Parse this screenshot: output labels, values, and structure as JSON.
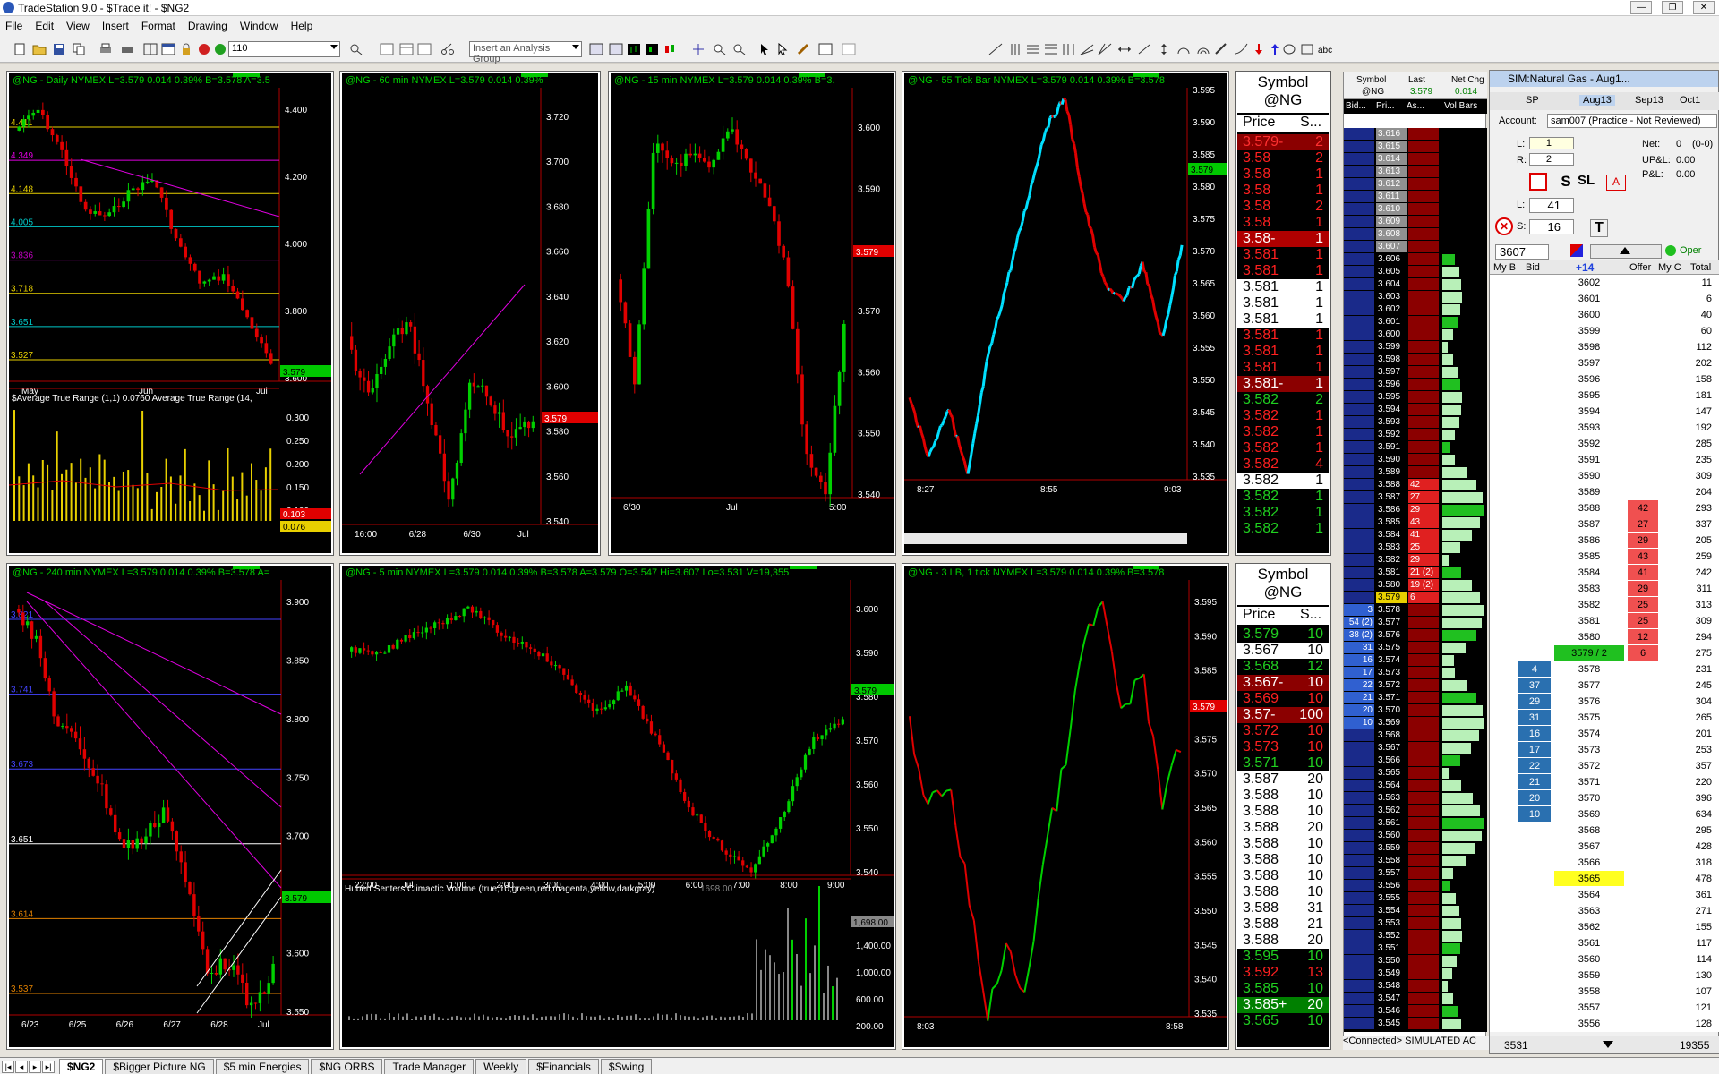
{
  "app": {
    "title": "TradeStation 9.0 - $Trade it! - $NG2"
  },
  "menu": [
    "File",
    "Edit",
    "View",
    "Insert",
    "Format",
    "Drawing",
    "Window",
    "Help"
  ],
  "toolbar": {
    "interval_value": "110",
    "analysis_group_placeholder": "Insert an Analysis Group"
  },
  "charts": [
    {
      "header": "@NG - Daily  NYMEX  L=3.579  0.014   0.39%   B=3.578  A=3.5",
      "levels": [
        "4.411",
        "4.349",
        "4.148",
        "4.005",
        "3.836",
        "3.718",
        "3.651",
        "3.527"
      ],
      "axis": [
        "4.400",
        "4.200",
        "4.000",
        "3.800",
        "3.600"
      ],
      "price_tag": "3.579",
      "indicator": "$Average True Range (1,1)   0.0760  Average True Range (14,",
      "ind_axis": [
        "0.300",
        "0.250",
        "0.200",
        "0.150",
        "0.100"
      ],
      "ind_tags": [
        "0.103",
        "0.076"
      ],
      "xlabels": [
        "May",
        "Jun",
        "Jul"
      ]
    },
    {
      "header": "@NG - 60 min  NYMEX  L=3.579  0.014   0.39%",
      "axis": [
        "3.720",
        "3.700",
        "3.680",
        "3.660",
        "3.640",
        "3.620",
        "3.600",
        "3.580",
        "3.560",
        "3.540"
      ],
      "price_tag": "3.579",
      "xlabels": [
        "16:00",
        "6/28",
        "6/30",
        "Jul"
      ]
    },
    {
      "header": "@NG - 15 min  NYMEX  L=3.579  0.014   0.39%   B=3.",
      "axis": [
        "3.600",
        "3.590",
        "3.580",
        "3.570",
        "3.560",
        "3.550",
        "3.540"
      ],
      "price_tag": "3.579",
      "xlabels": [
        "6/30",
        "Jul",
        "5:00"
      ]
    },
    {
      "header": "@NG - 55 Tick Bar  NYMEX  L=3.579  0.014   0.39%   B=3.578",
      "axis": [
        "3.595",
        "3.590",
        "3.585",
        "3.580",
        "3.575",
        "3.570",
        "3.565",
        "3.560",
        "3.555",
        "3.550",
        "3.545",
        "3.540",
        "3.535"
      ],
      "price_tag": "3.579",
      "xlabels": [
        "8:27",
        "8:55",
        "9:03"
      ]
    },
    {
      "header": "@NG - 240 min  NYMEX  L=3.579  0.014   0.39%   B=3.578  A=",
      "levels": [
        "3.821",
        "3.741",
        "3.673",
        "3.651",
        "3.614",
        "3.537"
      ],
      "axis": [
        "3.900",
        "3.850",
        "3.800",
        "3.750",
        "3.700",
        "3.650",
        "3.600",
        "3.550"
      ],
      "price_tag": "3.579",
      "xlabels": [
        "6/23",
        "6/25",
        "6/26",
        "6/27",
        "6/28",
        "Jul"
      ]
    },
    {
      "header": "@NG - 5 min  NYMEX  L=3.579  0.014   0.39%   B=3.578  A=3.579  O=3.547  Hi=3.607  Lo=3.531  V=19,355",
      "axis": [
        "3.600",
        "3.590",
        "3.580",
        "3.570",
        "3.560",
        "3.550",
        "3.540"
      ],
      "price_tag": "3.579",
      "indicator": "Hubert Senters Climactic Volume (true,10,green,red,magenta,yellow,darkgray)",
      "ind_value": "1698.00",
      "ind_axis": [
        "1,800.00",
        "1,400.00",
        "1,000.00",
        "600.00",
        "200.00"
      ],
      "ind_tag": "1,698.00",
      "xlabels": [
        "22:00",
        "Jul",
        "1:00",
        "2:00",
        "3:00",
        "4:00",
        "5:00",
        "6:00",
        "7:00",
        "8:00",
        "9:00"
      ]
    },
    {
      "header": "@NG - 3 LB, 1 tick  NYMEX  L=3.579  0.014   0.39%   B=3.578",
      "axis": [
        "3.595",
        "3.590",
        "3.585",
        "3.580",
        "3.575",
        "3.570",
        "3.565",
        "3.560",
        "3.555",
        "3.550",
        "3.545",
        "3.540",
        "3.535"
      ],
      "price_tag": "3.579",
      "xlabels": [
        "8:03",
        "8:58"
      ]
    }
  ],
  "tape_top": {
    "title": "Symbol",
    "symbol": "@NG",
    "col_price": "Price",
    "col_size": "S...",
    "rows": [
      {
        "p": "3.579-",
        "s": "2",
        "c": "#ff3030",
        "bg": "#8b0000"
      },
      {
        "p": "3.58",
        "s": "2",
        "c": "#ff2020",
        "bg": ""
      },
      {
        "p": "3.58",
        "s": "1",
        "c": "#ff2020",
        "bg": ""
      },
      {
        "p": "3.58",
        "s": "1",
        "c": "#ff2020",
        "bg": ""
      },
      {
        "p": "3.58",
        "s": "2",
        "c": "#ff2020",
        "bg": ""
      },
      {
        "p": "3.58",
        "s": "1",
        "c": "#ff2020",
        "bg": ""
      },
      {
        "p": "3.58-",
        "s": "1",
        "c": "#ffffff",
        "bg": "#b00000"
      },
      {
        "p": "3.581",
        "s": "1",
        "c": "#ff2020",
        "bg": ""
      },
      {
        "p": "3.581",
        "s": "1",
        "c": "#ff2020",
        "bg": ""
      },
      {
        "p": "3.581",
        "s": "1",
        "c": "#000000",
        "bg": "#ffffff"
      },
      {
        "p": "3.581",
        "s": "1",
        "c": "#000000",
        "bg": "#ffffff"
      },
      {
        "p": "3.581",
        "s": "1",
        "c": "#000000",
        "bg": "#ffffff"
      },
      {
        "p": "3.581",
        "s": "1",
        "c": "#ff2020",
        "bg": ""
      },
      {
        "p": "3.581",
        "s": "1",
        "c": "#ff2020",
        "bg": ""
      },
      {
        "p": "3.581",
        "s": "1",
        "c": "#ff2020",
        "bg": ""
      },
      {
        "p": "3.581-",
        "s": "1",
        "c": "#ffffff",
        "bg": "#8b0000"
      },
      {
        "p": "3.582",
        "s": "2",
        "c": "#20d020",
        "bg": ""
      },
      {
        "p": "3.582",
        "s": "1",
        "c": "#ff2020",
        "bg": ""
      },
      {
        "p": "3.582",
        "s": "1",
        "c": "#ff2020",
        "bg": ""
      },
      {
        "p": "3.582",
        "s": "1",
        "c": "#ff2020",
        "bg": ""
      },
      {
        "p": "3.582",
        "s": "4",
        "c": "#ff2020",
        "bg": ""
      },
      {
        "p": "3.582",
        "s": "1",
        "c": "#000000",
        "bg": "#ffffff"
      },
      {
        "p": "3.582",
        "s": "1",
        "c": "#20d020",
        "bg": ""
      },
      {
        "p": "3.582",
        "s": "1",
        "c": "#20d020",
        "bg": ""
      },
      {
        "p": "3.582",
        "s": "1",
        "c": "#20d020",
        "bg": ""
      }
    ]
  },
  "tape_bottom": {
    "title": "Symbol",
    "symbol": "@NG",
    "col_price": "Price",
    "col_size": "S...",
    "rows": [
      {
        "p": "3.579",
        "s": "10",
        "c": "#20d020",
        "bg": ""
      },
      {
        "p": "3.567",
        "s": "10",
        "c": "#000000",
        "bg": "#ffffff"
      },
      {
        "p": "3.568",
        "s": "12",
        "c": "#20d020",
        "bg": ""
      },
      {
        "p": "3.567-",
        "s": "10",
        "c": "#ffffff",
        "bg": "#8b0000"
      },
      {
        "p": "3.569",
        "s": "10",
        "c": "#ff2020",
        "bg": ""
      },
      {
        "p": "3.57-",
        "s": "100",
        "c": "#ffffff",
        "bg": "#8b0000"
      },
      {
        "p": "3.572",
        "s": "10",
        "c": "#ff2020",
        "bg": ""
      },
      {
        "p": "3.573",
        "s": "10",
        "c": "#ff2020",
        "bg": ""
      },
      {
        "p": "3.571",
        "s": "10",
        "c": "#20d020",
        "bg": ""
      },
      {
        "p": "3.587",
        "s": "20",
        "c": "#000000",
        "bg": "#ffffff"
      },
      {
        "p": "3.588",
        "s": "10",
        "c": "#000000",
        "bg": "#ffffff"
      },
      {
        "p": "3.588",
        "s": "10",
        "c": "#000000",
        "bg": "#ffffff"
      },
      {
        "p": "3.588",
        "s": "20",
        "c": "#000000",
        "bg": "#ffffff"
      },
      {
        "p": "3.588",
        "s": "10",
        "c": "#000000",
        "bg": "#ffffff"
      },
      {
        "p": "3.588",
        "s": "10",
        "c": "#000000",
        "bg": "#ffffff"
      },
      {
        "p": "3.588",
        "s": "10",
        "c": "#000000",
        "bg": "#ffffff"
      },
      {
        "p": "3.588",
        "s": "10",
        "c": "#000000",
        "bg": "#ffffff"
      },
      {
        "p": "3.588",
        "s": "31",
        "c": "#000000",
        "bg": "#ffffff"
      },
      {
        "p": "3.588",
        "s": "21",
        "c": "#000000",
        "bg": "#ffffff"
      },
      {
        "p": "3.588",
        "s": "20",
        "c": "#000000",
        "bg": "#ffffff"
      },
      {
        "p": "3.595",
        "s": "10",
        "c": "#20d020",
        "bg": ""
      },
      {
        "p": "3.592",
        "s": "13",
        "c": "#ff2020",
        "bg": ""
      },
      {
        "p": "3.585",
        "s": "10",
        "c": "#20d020",
        "bg": ""
      },
      {
        "p": "3.585+",
        "s": "20",
        "c": "#ffffff",
        "bg": "#008000"
      },
      {
        "p": "3.565",
        "s": "10",
        "c": "#20d020",
        "bg": ""
      }
    ]
  },
  "ladder": {
    "headers": [
      "Symbol",
      "Last",
      "Net Chg"
    ],
    "symbol": "@NG",
    "last": "3.579",
    "net_chg": "0.014",
    "sub_headers": [
      "Bid...",
      "Pri...",
      "As...",
      "Vol Bars"
    ],
    "prices": [
      "3.616",
      "3.615",
      "3.614",
      "3.613",
      "3.612",
      "3.611",
      "3.610",
      "3.609",
      "3.608",
      "3.607",
      "3.606",
      "3.605",
      "3.604",
      "3.603",
      "3.602",
      "3.601",
      "3.600",
      "3.599",
      "3.598",
      "3.597",
      "3.596",
      "3.595",
      "3.594",
      "3.593",
      "3.592",
      "3.591",
      "3.590",
      "3.589",
      "3.588",
      "3.587",
      "3.586",
      "3.585",
      "3.584",
      "3.583",
      "3.582",
      "3.581",
      "3.580",
      "3.579",
      "3.578",
      "3.577",
      "3.576",
      "3.575",
      "3.574",
      "3.573",
      "3.572",
      "3.571",
      "3.570",
      "3.569",
      "3.568",
      "3.567",
      "3.566",
      "3.565",
      "3.564",
      "3.563",
      "3.562",
      "3.561",
      "3.560",
      "3.559",
      "3.558",
      "3.557",
      "3.556",
      "3.555",
      "3.554",
      "3.553",
      "3.552",
      "3.551",
      "3.550",
      "3.549",
      "3.548",
      "3.547",
      "3.546",
      "3.545"
    ],
    "asks": {
      "3.588": "42",
      "3.587": "27",
      "3.586": "29",
      "3.585": "43",
      "3.584": "41",
      "3.583": "25",
      "3.582": "29",
      "3.581": "21 (2)",
      "3.580": "19 (2)",
      "3.579": "6"
    },
    "bids": {
      "3.578": "3",
      "3.577": "54 (2)",
      "3.576": "38 (2)",
      "3.575": "31",
      "3.574": "16",
      "3.573": "17",
      "3.572": "22",
      "3.571": "21",
      "3.570": "20",
      "3.569": "10"
    },
    "status": "<Connected> SIMULATED AC"
  },
  "sim": {
    "title": "SIM:Natural Gas - Aug1...",
    "contracts": [
      "SP",
      "Aug13",
      "Sep13",
      "Oct1"
    ],
    "account_label": "Account:",
    "account_value": "sam007 (Practice - Not Reviewed)",
    "l_label": "L:",
    "l_value": "1",
    "r_label": "R:",
    "r_value": "2",
    "net_label": "Net:",
    "net_value": "0",
    "net_extra": "(0-0)",
    "upl_label": "UP&L:",
    "upl_value": "0.00",
    "pl_label": "P&L:",
    "pl_value": "0.00",
    "qty_l_label": "L:",
    "qty_l": "41",
    "qty_s_label": "S:",
    "qty_s": "16",
    "price_box": "3607",
    "open_label": "Oper",
    "columns": [
      "My B",
      "Bid",
      "+14",
      "Offer",
      "My C",
      "Total"
    ],
    "rows": [
      {
        "price": "3602",
        "total": "11"
      },
      {
        "price": "3601",
        "total": "6"
      },
      {
        "price": "3600",
        "total": "40"
      },
      {
        "price": "3599",
        "total": "60"
      },
      {
        "price": "3598",
        "total": "112"
      },
      {
        "price": "3597",
        "total": "202"
      },
      {
        "price": "3596",
        "total": "158"
      },
      {
        "price": "3595",
        "total": "181"
      },
      {
        "price": "3594",
        "total": "147"
      },
      {
        "price": "3593",
        "total": "192"
      },
      {
        "price": "3592",
        "total": "285"
      },
      {
        "price": "3591",
        "total": "235"
      },
      {
        "price": "3590",
        "total": "309"
      },
      {
        "price": "3589",
        "total": "204"
      },
      {
        "price": "3588",
        "offer": "42",
        "total": "293"
      },
      {
        "price": "3587",
        "offer": "27",
        "total": "337"
      },
      {
        "price": "3586",
        "offer": "29",
        "total": "205"
      },
      {
        "price": "3585",
        "offer": "43",
        "total": "259"
      },
      {
        "price": "3584",
        "offer": "41",
        "total": "242"
      },
      {
        "price": "3583",
        "offer": "29",
        "total": "311"
      },
      {
        "price": "3582",
        "offer": "25",
        "total": "313"
      },
      {
        "price": "3581",
        "offer": "25",
        "total": "309"
      },
      {
        "price": "3580",
        "offer": "12",
        "total": "294"
      },
      {
        "price": "3579 / 2",
        "offer": "6",
        "total": "275",
        "last": true
      },
      {
        "price": "3578",
        "bid": "4",
        "total": "231"
      },
      {
        "price": "3577",
        "bid": "37",
        "total": "245"
      },
      {
        "price": "3576",
        "bid": "29",
        "total": "304"
      },
      {
        "price": "3575",
        "bid": "31",
        "total": "265"
      },
      {
        "price": "3574",
        "bid": "16",
        "total": "201"
      },
      {
        "price": "3573",
        "bid": "17",
        "total": "253"
      },
      {
        "price": "3572",
        "bid": "22",
        "total": "357"
      },
      {
        "price": "3571",
        "bid": "21",
        "total": "220"
      },
      {
        "price": "3570",
        "bid": "20",
        "total": "396"
      },
      {
        "price": "3569",
        "bid": "10",
        "total": "634"
      },
      {
        "price": "3568",
        "total": "295"
      },
      {
        "price": "3567",
        "total": "428"
      },
      {
        "price": "3566",
        "total": "318"
      },
      {
        "price": "3565",
        "total": "478",
        "hl": true
      },
      {
        "price": "3564",
        "total": "361"
      },
      {
        "price": "3563",
        "total": "271"
      },
      {
        "price": "3562",
        "total": "155"
      },
      {
        "price": "3561",
        "total": "117"
      },
      {
        "price": "3560",
        "total": "114"
      },
      {
        "price": "3559",
        "total": "130"
      },
      {
        "price": "3558",
        "total": "107"
      },
      {
        "price": "3557",
        "total": "121"
      },
      {
        "price": "3556",
        "total": "128"
      }
    ],
    "footer_left": "3531",
    "footer_right": "19355"
  },
  "tabs": [
    "$NG2",
    "$Bigger Picture NG",
    "$5 min Energies",
    "$NG ORBS",
    "Trade Manager",
    "Weekly",
    "$Financials",
    "$Swing"
  ]
}
